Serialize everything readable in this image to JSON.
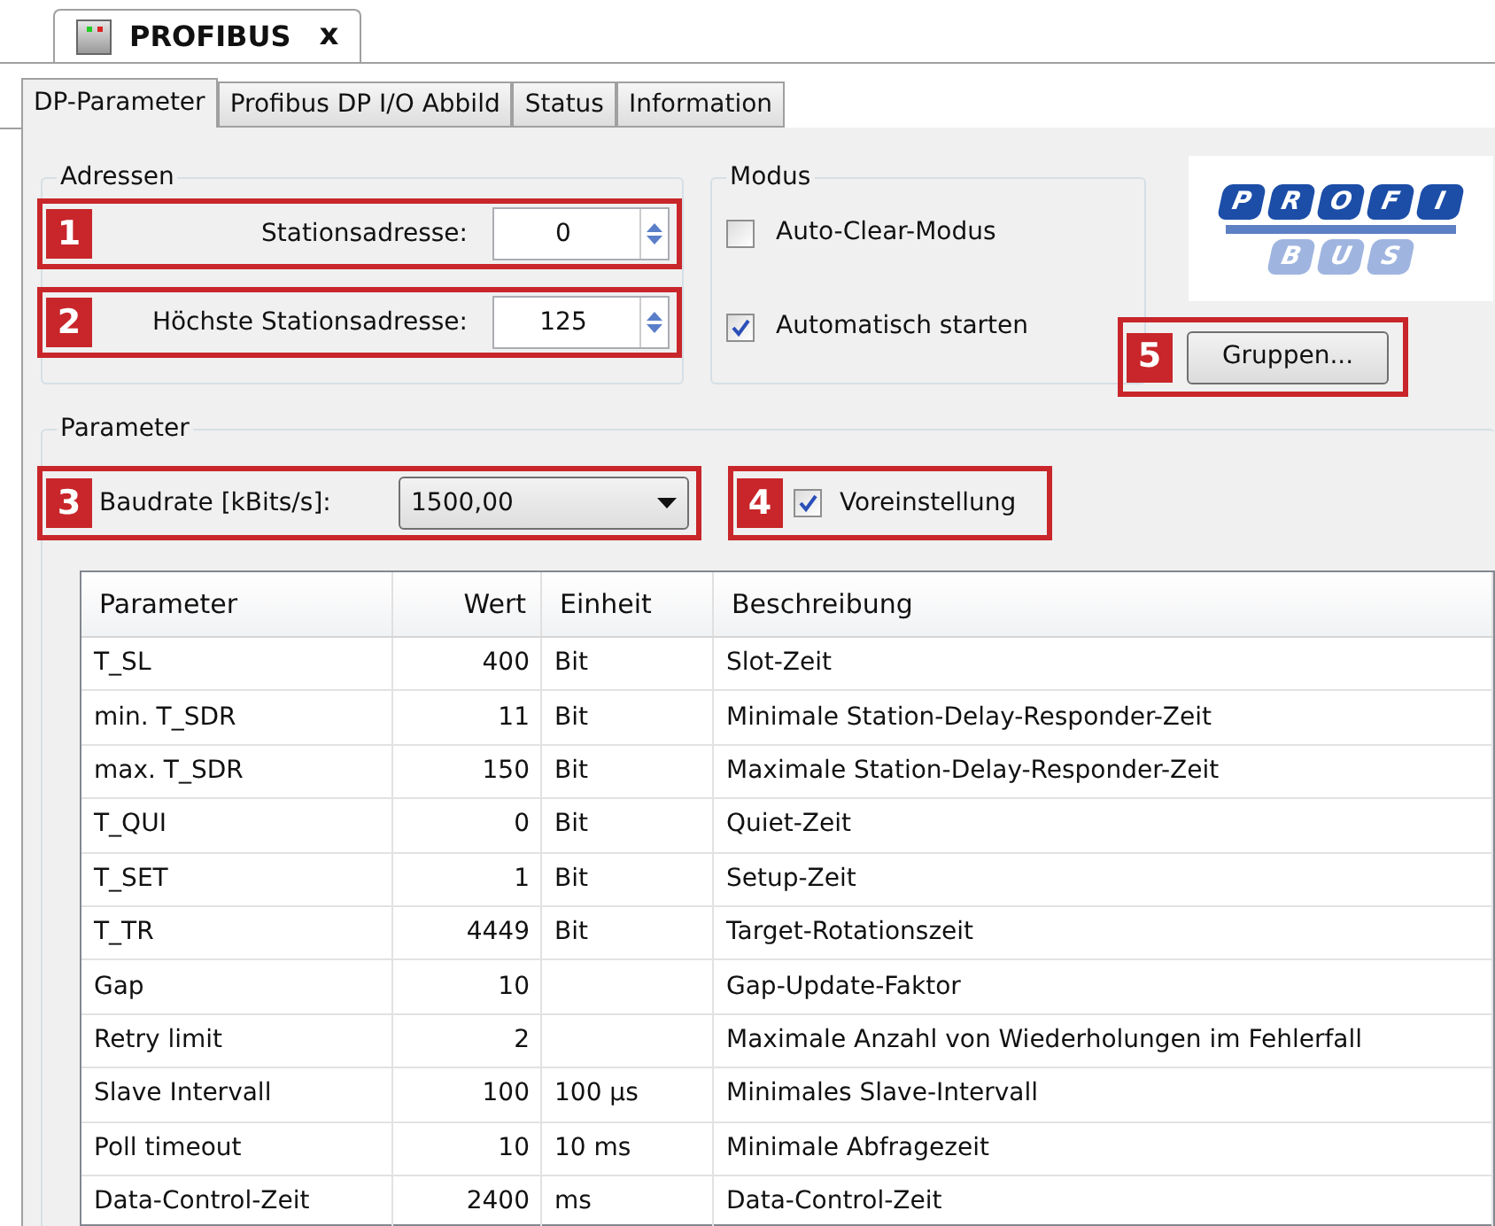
{
  "document_tab": {
    "title": "PROFIBUS",
    "close": "x"
  },
  "tabs": [
    {
      "label": "DP-Parameter",
      "selected": true
    },
    {
      "label": "Profibus DP I/O Abbild",
      "selected": false
    },
    {
      "label": "Status",
      "selected": false
    },
    {
      "label": "Information",
      "selected": false
    }
  ],
  "adressen": {
    "title": "Adressen",
    "fields": [
      {
        "callout": "1",
        "label": "Stationsadresse:",
        "value": "0"
      },
      {
        "callout": "2",
        "label": "Höchste Stationsadresse:",
        "value": "125"
      }
    ]
  },
  "modus": {
    "title": "Modus",
    "options": [
      {
        "label": "Auto-Clear-Modus",
        "checked": false
      },
      {
        "label": "Automatisch starten",
        "checked": true
      }
    ]
  },
  "logo": {
    "top": [
      "P",
      "R",
      "O",
      "F",
      "I"
    ],
    "bottom": [
      "B",
      "U",
      "S"
    ]
  },
  "groups_button": {
    "callout": "5",
    "label": "Gruppen..."
  },
  "parameter": {
    "title": "Parameter",
    "baudrate": {
      "callout": "3",
      "label": "Baudrate [kBits/s]:",
      "value": "1500,00"
    },
    "preset": {
      "callout": "4",
      "label": "Voreinstellung",
      "checked": true
    }
  },
  "table": {
    "columns": [
      "Parameter",
      "Wert",
      "Einheit",
      "Beschreibung"
    ],
    "rows": [
      [
        "T_SL",
        "400",
        "Bit",
        "Slot-Zeit"
      ],
      [
        "min. T_SDR",
        "11",
        "Bit",
        "Minimale Station-Delay-Responder-Zeit"
      ],
      [
        "max. T_SDR",
        "150",
        "Bit",
        "Maximale Station-Delay-Responder-Zeit"
      ],
      [
        "T_QUI",
        "0",
        "Bit",
        "Quiet-Zeit"
      ],
      [
        "T_SET",
        "1",
        "Bit",
        "Setup-Zeit"
      ],
      [
        "T_TR",
        "4449",
        "Bit",
        "Target-Rotationszeit"
      ],
      [
        "Gap",
        "10",
        "",
        "Gap-Update-Faktor"
      ],
      [
        "Retry limit",
        "2",
        "",
        "Maximale Anzahl von Wiederholungen im Fehlerfall"
      ],
      [
        "Slave Intervall",
        "100",
        "100 µs",
        "Minimales Slave-Intervall"
      ],
      [
        "Poll timeout",
        "10",
        "10 ms",
        "Minimale Abfragezeit"
      ],
      [
        "Data-Control-Zeit",
        "2400",
        "ms",
        "Data-Control-Zeit"
      ]
    ]
  }
}
